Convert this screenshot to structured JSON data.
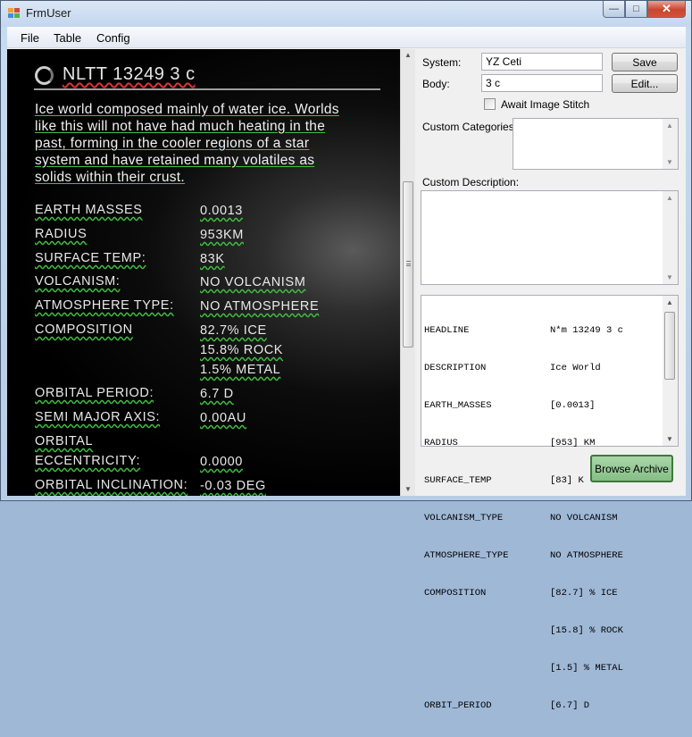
{
  "window": {
    "title": "FrmUser",
    "close_glyph": "✕",
    "min_glyph": "—",
    "max_glyph": "□"
  },
  "menu": [
    "File",
    "Table",
    "Config"
  ],
  "game": {
    "body_name": "NLTT 13249 3 c",
    "description_lines": [
      "Ice world composed mainly of water ice. Worlds",
      "like this will not have had much heating in the",
      "past, forming in the cooler regions of a star",
      "system and have retained many volatiles as",
      "solids within their crust."
    ],
    "rows": [
      {
        "key": "EARTH MASSES",
        "value": "0.0013"
      },
      {
        "key": "RADIUS",
        "value": "953KM"
      },
      {
        "key": "SURFACE TEMP:",
        "value": "83K"
      },
      {
        "key": "VOLCANISM:",
        "value": "NO VOLCANISM"
      },
      {
        "key": "ATMOSPHERE TYPE:",
        "value": "NO ATMOSPHERE"
      },
      {
        "key": "COMPOSITION",
        "value": "82.7% ICE"
      },
      {
        "key": "",
        "value": "15.8% ROCK"
      },
      {
        "key": "",
        "value": "1.5% METAL"
      },
      {
        "key": "ORBITAL PERIOD:",
        "value": "6.7 D"
      },
      {
        "key": "SEMI MAJOR AXIS:",
        "value": "0.00AU"
      },
      {
        "key": "ORBITAL",
        "value": ""
      },
      {
        "key": "ECCENTRICITY:",
        "value": "0.0000"
      },
      {
        "key": "ORBITAL INCLINATION:",
        "value": "-0.03 DEG"
      }
    ]
  },
  "form": {
    "system_label": "System:",
    "system_value": "YZ Ceti",
    "body_label": "Body:",
    "body_value": "3 c",
    "save_label": "Save",
    "edit_label": "Edit...",
    "await_label": "Await Image Stitch",
    "custom_categories_label": "Custom Categories:",
    "custom_description_label": "Custom Description:",
    "browse_label": "Browse Archive"
  },
  "raw": [
    {
      "key": "HEADLINE",
      "value": "N*m 13249 3 c"
    },
    {
      "key": "DESCRIPTION",
      "value": "Ice World"
    },
    {
      "key": "EARTH_MASSES",
      "value": "[0.0013]"
    },
    {
      "key": "RADIUS",
      "value": "[953] KM"
    },
    {
      "key": "SURFACE_TEMP",
      "value": "[83] K"
    },
    {
      "key": "VOLCANISM_TYPE",
      "value": "NO VOLCANISM"
    },
    {
      "key": "ATMOSPHERE_TYPE",
      "value": "NO ATMOSPHERE"
    },
    {
      "key": "COMPOSITION",
      "value": "[82.7] % ICE"
    },
    {
      "key": "",
      "value": "[15.8] % ROCK"
    },
    {
      "key": "",
      "value": "[1.5] % METAL"
    },
    {
      "key": "ORBIT_PERIOD",
      "value": "[6.7] D"
    }
  ],
  "colors": {
    "browse_accent": "#8fc38f",
    "close_red": "#c7462e"
  },
  "icons": {
    "scroll_up": "▲",
    "scroll_down": "▼"
  }
}
